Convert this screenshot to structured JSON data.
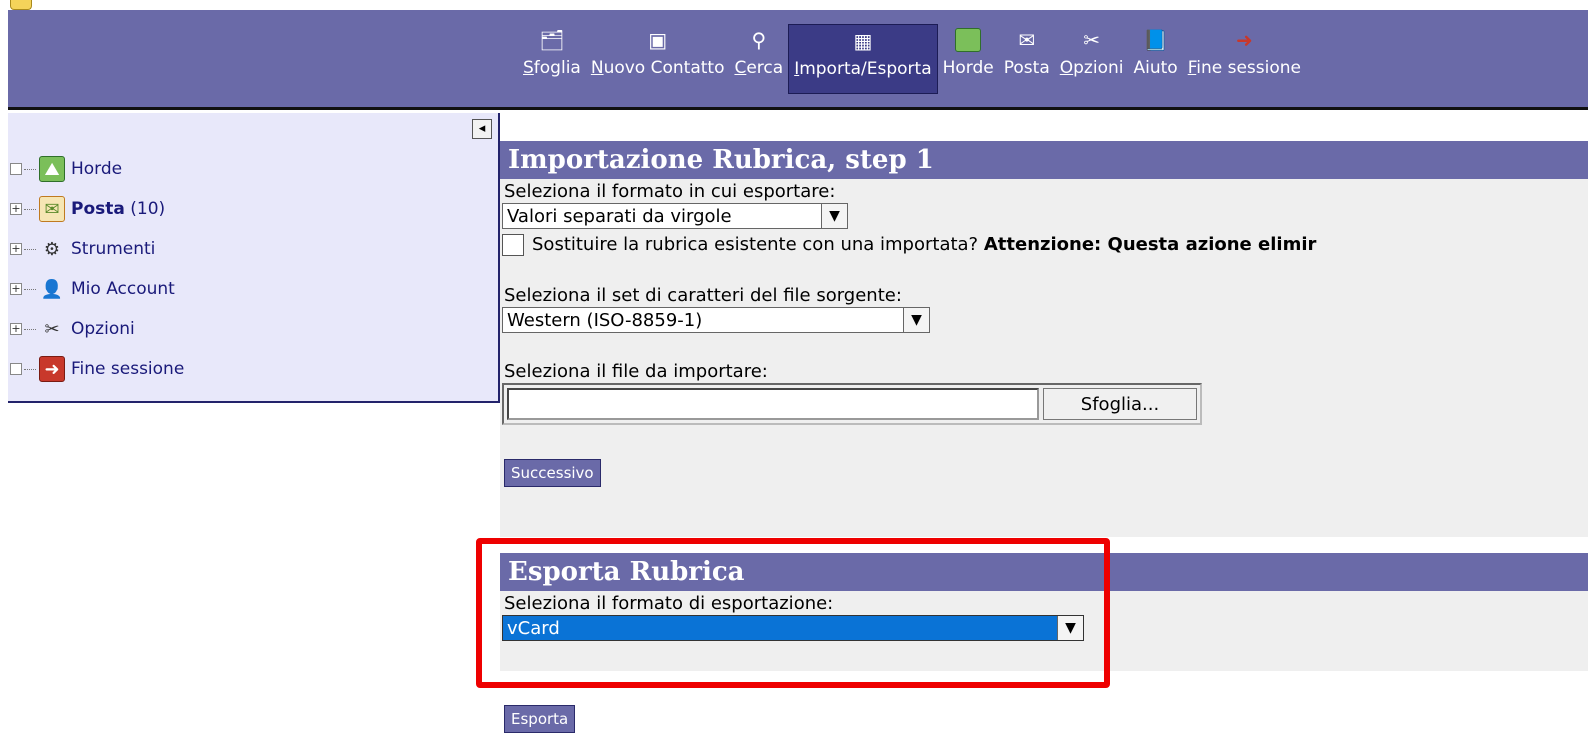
{
  "toolbar": {
    "items": [
      {
        "label_acc": "S",
        "label_rest": "foglia",
        "icon": "browse-icon"
      },
      {
        "label_acc": "N",
        "label_rest": "uovo Contatto",
        "icon": "new-contact-icon"
      },
      {
        "label_acc": "C",
        "label_rest": "erca",
        "icon": "search-icon"
      },
      {
        "label_acc": "I",
        "label_rest": "mporta/Esporta",
        "icon": "import-export-icon"
      },
      {
        "label_acc": "",
        "label_rest": "Horde",
        "icon": "horde-map-icon"
      },
      {
        "label_acc": "",
        "label_rest": "Posta",
        "icon": "mail-icon"
      },
      {
        "label_acc": "O",
        "label_rest": "pzioni",
        "icon": "options-icon"
      },
      {
        "label_acc": "",
        "label_rest": "Aiuto",
        "icon": "help-book-icon"
      },
      {
        "label_acc": "F",
        "label_rest": "ine sessione",
        "icon": "logout-icon"
      }
    ]
  },
  "sidebar": {
    "items": [
      {
        "label": "Horde",
        "icon": "horde-map-icon",
        "expand": "□"
      },
      {
        "label": "Posta",
        "count": "(10)",
        "icon": "mail-icon",
        "expand": "+"
      },
      {
        "label": "Strumenti",
        "icon": "tools-icon",
        "expand": "+"
      },
      {
        "label": "Mio Account",
        "icon": "user-icon",
        "expand": "+"
      },
      {
        "label": "Opzioni",
        "icon": "options-icon",
        "expand": "+"
      },
      {
        "label": "Fine sessione",
        "icon": "logout-icon",
        "expand": "□"
      }
    ]
  },
  "import": {
    "title": "Importazione Rubrica, step 1",
    "format_label": "Seleziona il formato in cui esportare:",
    "format_value": "Valori separati da virgole",
    "replace_label": "Sostituire la rubrica esistente con una importata?",
    "replace_warning": "Attenzione: Questa azione elimir",
    "charset_label": "Seleziona il set di caratteri del file sorgente:",
    "charset_value": "Western (ISO-8859-1)",
    "file_label": "Seleziona il file da importare:",
    "browse_button": "Sfoglia...",
    "next_button": "Successivo"
  },
  "export": {
    "title": "Esporta Rubrica",
    "format_label": "Seleziona il formato di esportazione:",
    "format_value": "vCard",
    "export_button": "Esporta"
  },
  "colors": {
    "header": "#6a6aa8",
    "highlight": "#ee0000",
    "selection": "#0a73d6"
  }
}
